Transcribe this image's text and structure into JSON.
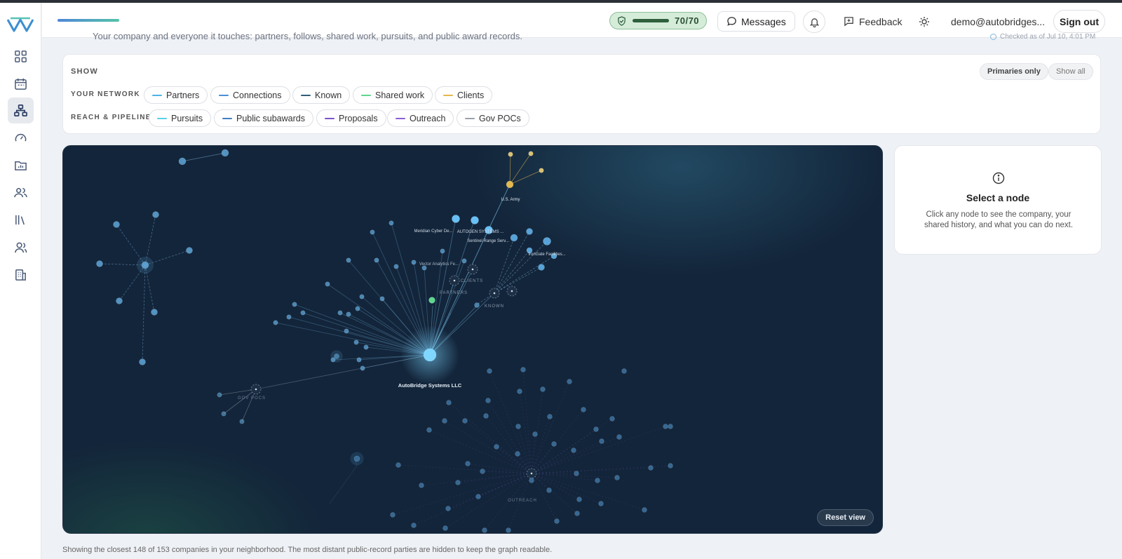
{
  "header": {
    "score": "70/70",
    "score_level": 1.0,
    "messages_label": "Messages",
    "feedback_label": "Feedback",
    "user_email": "demo@autobridges...",
    "signout_label": "Sign out"
  },
  "page": {
    "subtitle": "Your company and everyone it touches: partners, follows, shared work, pursuits, and public award records.",
    "checked": "Checked as of Jul 10, 4:01 PM"
  },
  "filters": {
    "show_label": "SHOW",
    "primaries_only": "Primaries only",
    "show_all": "Show all",
    "network_label": "YOUR NETWORK",
    "network_chips": [
      {
        "label": "Partners",
        "color": "#4db4e6"
      },
      {
        "label": "Connections",
        "color": "#4a8fd6"
      },
      {
        "label": "Known",
        "color": "#2f5f7a"
      },
      {
        "label": "Shared work",
        "color": "#5fd68c"
      },
      {
        "label": "Clients",
        "color": "#e5b84c"
      }
    ],
    "reach_label": "REACH & PIPELINE",
    "reach_chips": [
      {
        "label": "Pursuits",
        "color": "#5ad0e8"
      },
      {
        "label": "Public subawards",
        "color": "#3f7fc4"
      },
      {
        "label": "Proposals",
        "color": "#7b52c9"
      },
      {
        "label": "Outreach",
        "color": "#8a5fd6"
      },
      {
        "label": "Gov POCs",
        "color": "#9aa1aa"
      }
    ]
  },
  "graph": {
    "node_labels": {
      "center": "AutoBridge Systems LLC",
      "army": "U.S. Army",
      "meridian": "Meridian Cyber De...",
      "overlap": "AUTOGEN SYSTEMS ...",
      "sentinel": "Sentinel Range Serv...",
      "vector": "Vector Analytics Fe...",
      "irongate": "IronGate Facilities..."
    },
    "hub_labels": {
      "clients": "CLIENTS",
      "partners": "PARTNERS",
      "known": "KNOWN",
      "govpocs": "GOV POCS",
      "outreach": "OUTREACH"
    },
    "reset_label": "Reset view"
  },
  "panel": {
    "title": "Select a node",
    "body": "Click any node to see the company, your shared history, and what you can do next."
  },
  "footer": {
    "note": "Showing the closest 148 of 153 companies in your neighborhood. The most distant public-record parties are hidden to keep the graph readable."
  }
}
